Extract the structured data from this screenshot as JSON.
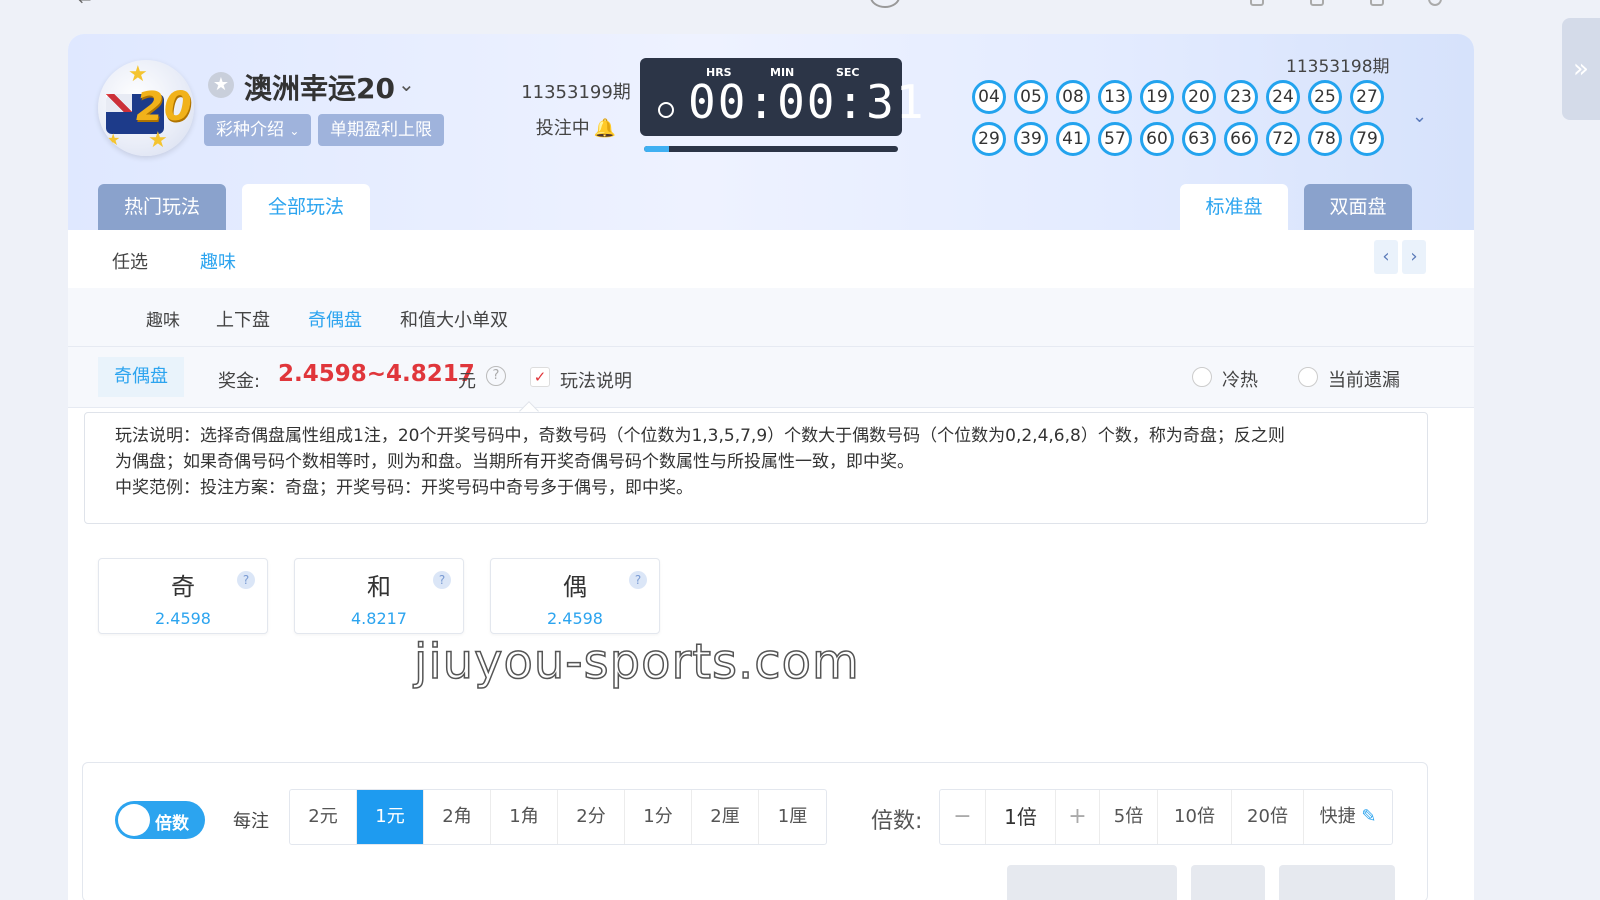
{
  "game": {
    "title": "澳洲幸运20",
    "intro_label": "彩种介绍",
    "limit_label": "单期盈利上限",
    "current_issue": "11353199期",
    "status": "投注中",
    "timer": {
      "hrs_label": "HRS",
      "min_label": "MIN",
      "sec_label": "SEC",
      "value": "00:00:31"
    },
    "progress_fraction": 0.1,
    "last_issue": "11353198期",
    "draw_numbers": [
      "04",
      "05",
      "08",
      "13",
      "19",
      "20",
      "23",
      "24",
      "25",
      "27",
      "29",
      "39",
      "41",
      "57",
      "60",
      "63",
      "66",
      "72",
      "78",
      "79"
    ]
  },
  "tabs": {
    "hot": "热门玩法",
    "all": "全部玩法",
    "standard": "标准盘",
    "double": "双面盘"
  },
  "categories": [
    "任选",
    "趣味"
  ],
  "subcategories": [
    "趣味",
    "上下盘",
    "奇偶盘",
    "和值大小单双"
  ],
  "play": {
    "name": "奇偶盘",
    "prize_label": "奖金:",
    "prize_value": "2.4598~4.8217",
    "prize_unit": "元",
    "help_label": "玩法说明",
    "cold_hot": "冷热",
    "missing": "当前遗漏"
  },
  "description": {
    "line1": "玩法说明：选择奇偶盘属性组成1注，20个开奖号码中，奇数号码（个位数为1,3,5,7,9）个数大于偶数号码（个位数为0,2,4,6,8）个数，称为奇盘；反之则",
    "line2": "为偶盘；如果奇偶号码个数相等时，则为和盘。当期所有开奖奇偶号码个数属性与所投属性一致，即中奖。",
    "line3": "中奖范例：投注方案：奇盘；开奖号码：开奖号码中奇号多于偶号，即中奖。"
  },
  "options": [
    {
      "name": "奇",
      "odds": "2.4598"
    },
    {
      "name": "和",
      "odds": "4.8217"
    },
    {
      "name": "偶",
      "odds": "2.4598"
    }
  ],
  "watermark": "jiuyou-sports.com",
  "bet": {
    "mode_label": "倍数",
    "per_bet_label": "每注",
    "units": [
      "2元",
      "1元",
      "2角",
      "1角",
      "2分",
      "1分",
      "2厘",
      "1厘"
    ],
    "active_unit": "1元",
    "multiplier_label": "倍数:",
    "multiplier_value": "1倍",
    "minus": "−",
    "plus": "+",
    "presets": [
      "5倍",
      "10倍",
      "20倍"
    ],
    "quick_label": "快捷"
  },
  "colors": {
    "accent": "#2ca4ef",
    "prize": "#e0363b",
    "ball_border": "#23a3ee",
    "timer_bg": "#2c3547"
  }
}
